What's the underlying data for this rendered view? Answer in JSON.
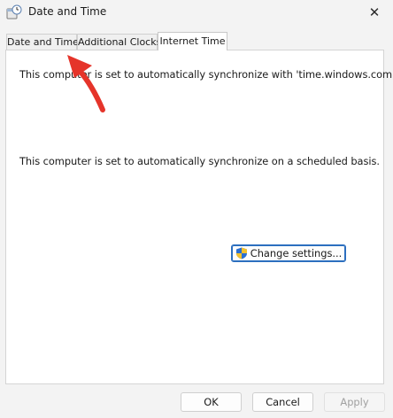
{
  "window": {
    "title": "Date and Time",
    "close_glyph": "✕"
  },
  "tabs": [
    {
      "label": "Date and Time"
    },
    {
      "label": "Additional Clocks"
    },
    {
      "label": "Internet Time"
    }
  ],
  "panel": {
    "line1": "This computer is set to automatically synchronize with 'time.windows.com'.",
    "line2": "This computer is set to automatically synchronize on a scheduled basis.",
    "change_settings": "Change settings..."
  },
  "footer": {
    "ok": "OK",
    "cancel": "Cancel",
    "apply": "Apply"
  },
  "colors": {
    "accent": "#2c6fbf",
    "arrow": "#e5342a"
  },
  "icons": {
    "app": "clock-globe-icon",
    "shield": "uac-shield-icon",
    "close": "close-icon"
  }
}
